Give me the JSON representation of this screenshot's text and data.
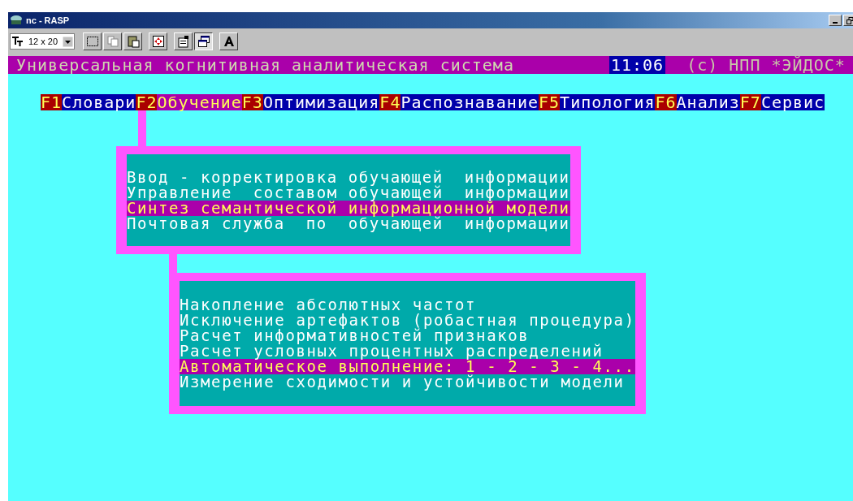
{
  "window": {
    "title": "nc - RASP"
  },
  "toolbar": {
    "font_size": "12 x 20"
  },
  "header": {
    "title": "Универсальная когнитивная аналитическая система",
    "clock": "11:06",
    "copyright": "(с) НПП *ЭЙДОС*"
  },
  "menu": [
    {
      "key": "F1",
      "label": "Словари",
      "selected": false
    },
    {
      "key": "F2",
      "label": "Обучение",
      "selected": true
    },
    {
      "key": "F3",
      "label": "Оптимизация",
      "selected": false
    },
    {
      "key": "F4",
      "label": "Распознавание",
      "selected": false
    },
    {
      "key": "F5",
      "label": "Типология",
      "selected": false
    },
    {
      "key": "F6",
      "label": "Анализ",
      "selected": false
    },
    {
      "key": "F7",
      "label": "Сервис",
      "selected": false
    }
  ],
  "submenu": [
    {
      "label": "Ввод - корректировка обучающей  информации",
      "selected": false
    },
    {
      "label": "Управление  составом обучающей  информации",
      "selected": false
    },
    {
      "label": "Синтез семантической информационной модели",
      "selected": true
    },
    {
      "label": "Почтовая служба  по  обучающей  информации",
      "selected": false
    }
  ],
  "submenu_2": [
    {
      "label": "Накопление абсолютных частот",
      "selected": false
    },
    {
      "label": "Исключение артефактов (робастная процедура)",
      "selected": false
    },
    {
      "label": "Расчет информативностей признаков",
      "selected": false
    },
    {
      "label": "Расчет условных процентных распределений",
      "selected": false
    },
    {
      "label": "Автоматическое выполнение: 1 - 2 - 3 - 4...",
      "selected": true
    },
    {
      "label": "Измерение сходимости и устойчивости модели",
      "selected": false
    }
  ]
}
